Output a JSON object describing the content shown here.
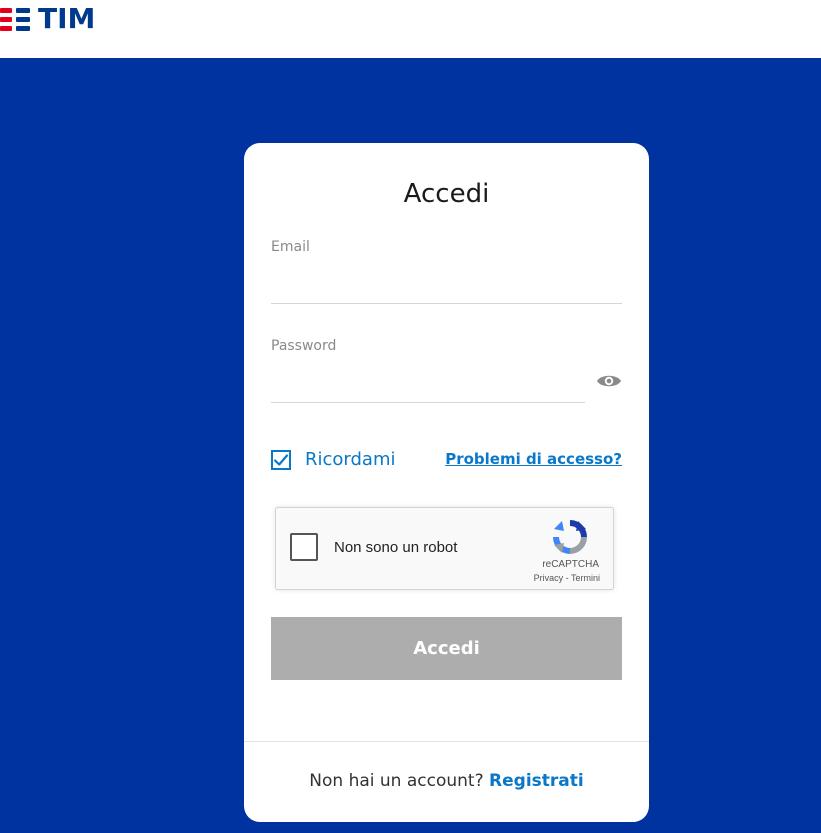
{
  "brand": {
    "name": "TIM",
    "colors": {
      "blue": "#003a8c",
      "red": "#e2001a",
      "hero": "#0033a0",
      "link": "#0a78c8"
    }
  },
  "login": {
    "title": "Accedi",
    "email": {
      "label": "Email",
      "value": ""
    },
    "password": {
      "label": "Password",
      "value": "",
      "toggle_icon": "eye-icon"
    },
    "remember": {
      "label": "Ricordami",
      "checked": true
    },
    "trouble_link": "Problemi di accesso?",
    "captcha": {
      "label": "Non sono un robot",
      "brand": "reCAPTCHA",
      "privacy": "Privacy",
      "separator": " - ",
      "terms": "Termini"
    },
    "submit_label": "Accedi",
    "submit_color": "#adadad"
  },
  "footer": {
    "prompt": "Non hai un account?",
    "register_link": "Registrati"
  }
}
